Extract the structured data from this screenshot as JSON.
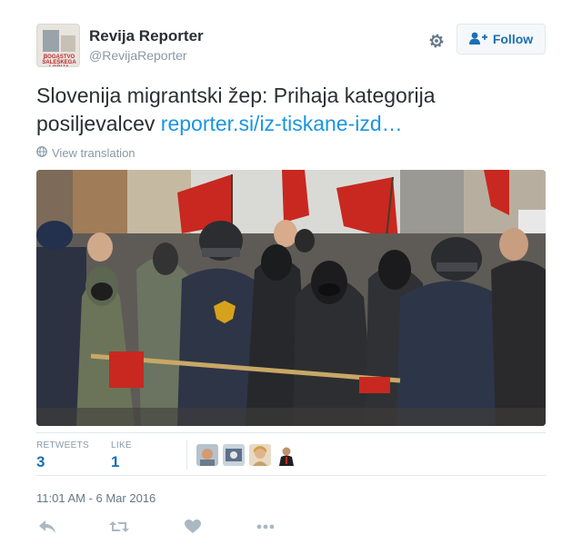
{
  "profile": {
    "display_name": "Revija Reporter",
    "screen_name": "@RevijaReporter",
    "avatar_caption": "BOGASTVO ŠALEŠKEGA LOBIJA"
  },
  "header": {
    "follow_label": "Follow"
  },
  "tweet": {
    "text": "Slovenija migrantski žep: Prihaja kategorija posiljevalcev ",
    "link_text": "reporter.si/iz-tiskane-izd…",
    "translate_label": "View translation",
    "photo_alt": "Protest with riot police and masked demonstrators holding red flags"
  },
  "stats": {
    "retweets_label": "RETWEETS",
    "retweets_count": "3",
    "likes_label": "LIKE",
    "likes_count": "1"
  },
  "timestamp": "11:01 AM - 6 Mar 2016",
  "colors": {
    "accent": "#1b95e0",
    "muted": "#8899a6",
    "text": "#292f33",
    "flag_red": "#c8281f"
  },
  "icons": {
    "settings": "gear-icon",
    "follow": "add-user-icon",
    "globe": "globe-icon",
    "reply": "reply-icon",
    "retweet": "retweet-icon",
    "like": "heart-icon",
    "more": "more-icon"
  }
}
